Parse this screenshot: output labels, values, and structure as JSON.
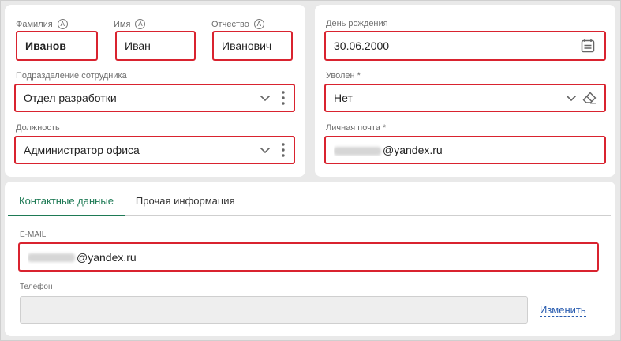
{
  "fields": {
    "surname": {
      "label": "Фамилия",
      "value": "Иванов"
    },
    "name": {
      "label": "Имя",
      "value": "Иван"
    },
    "patronymic": {
      "label": "Отчество",
      "value": "Иванович"
    },
    "auto_badge": "A",
    "department": {
      "label": "Подразделение сотрудника",
      "value": "Отдел разработки"
    },
    "position": {
      "label": "Должность",
      "value": "Администратор офиса"
    },
    "birthday": {
      "label": "День рождения",
      "value": "30.06.2000"
    },
    "dismissed": {
      "label": "Уволен *",
      "value": "Нет"
    },
    "personal_email": {
      "label": "Личная почта *",
      "value_suffix": "@yandex.ru"
    }
  },
  "tabs": [
    {
      "label": "Контактные данные",
      "active": true
    },
    {
      "label": "Прочая информация",
      "active": false
    }
  ],
  "contacts": {
    "email": {
      "label": "E-MAIL",
      "value_suffix": "@yandex.ru"
    },
    "phone": {
      "label": "Телефон",
      "value": ""
    },
    "change_link": "Изменить"
  },
  "colors": {
    "accent": "#1e7a55",
    "highlight": "#d9232f",
    "link": "#2a5db0"
  },
  "icons": [
    "calendar-icon",
    "chevron-down-icon",
    "more-vertical-icon",
    "eraser-icon"
  ]
}
